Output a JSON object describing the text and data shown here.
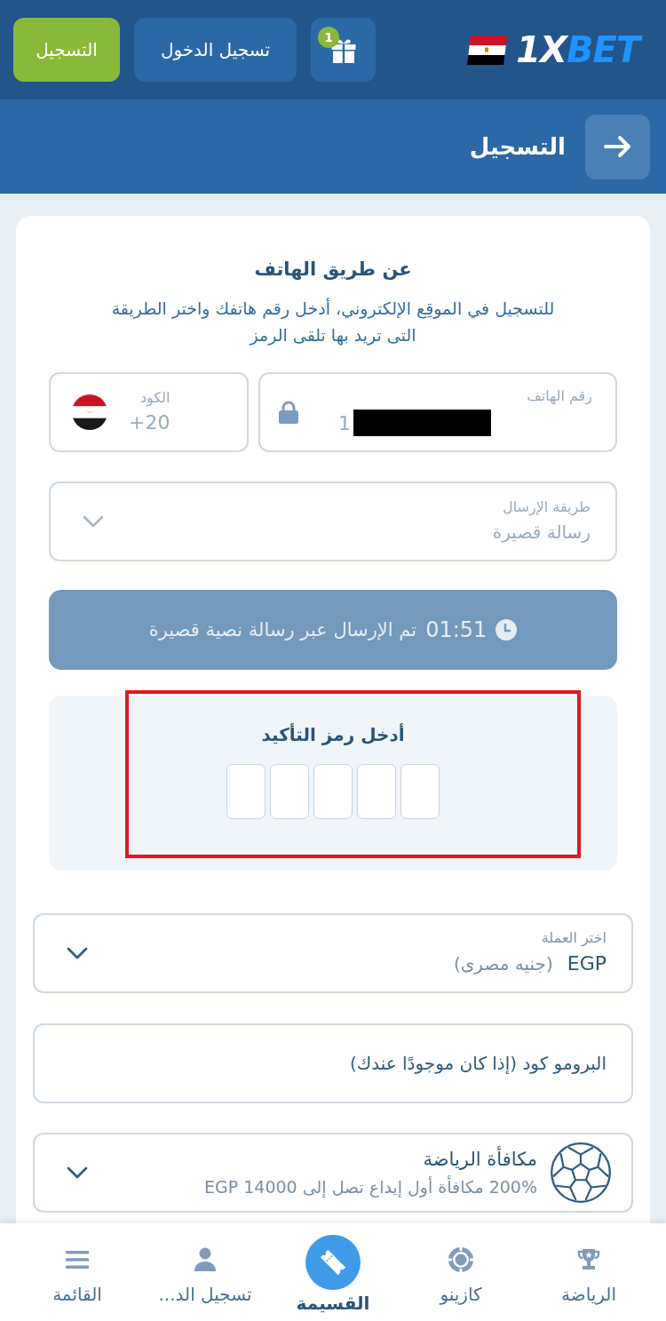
{
  "top_bar": {
    "logo": {
      "first_part": "1X",
      "second_part": "BET"
    },
    "gift_badge": "1",
    "login_button": "تسجيل الدخول",
    "register_button": "التسجيل"
  },
  "title_bar": {
    "title": "التسجيل"
  },
  "form": {
    "heading": "عن طريق الهاتف",
    "description": "للتسجيل في الموقِع الإلكتروني، أدخل رقم هاتفك واختر الطريقة التى تريد بها تلقى الرمز",
    "code_field": {
      "label": "الكود",
      "value": "+20"
    },
    "phone_field": {
      "label": "رقم الهاتف",
      "value": "1",
      "locked": true,
      "redacted": true
    },
    "send_method": {
      "label": "طريقة الإرسال",
      "value": "رسالة قصيرة"
    },
    "timer": {
      "time": "01:51",
      "message": "تم الإرسال عبر رسالة نصية قصيرة"
    },
    "confirmation": {
      "title": "أدخل رمز التأكيد",
      "highlighted": true,
      "cells": [
        {
          "filled": false
        },
        {
          "filled": false
        },
        {
          "filled": false
        },
        {
          "filled": false
        },
        {
          "filled": false
        }
      ]
    },
    "currency": {
      "label": "اختر العملة",
      "code": "EGP",
      "name": "(جنيه مصرى)"
    },
    "promo_code": {
      "placeholder": "البرومو كود (إذا كان موجودًا عندك)"
    },
    "bonus": {
      "title": "مكافأة الرياضة",
      "description": "200% مكافأة أول إيداع تصل إلى EGP 14000"
    }
  },
  "bottom_nav": [
    {
      "kind": "sports",
      "label": "الرياضة",
      "selected": false
    },
    {
      "kind": "casino",
      "label": "كازينو",
      "selected": false
    },
    {
      "kind": "coupon",
      "label": "القسيمة",
      "selected": true
    },
    {
      "kind": "login",
      "label": "تسجيل الد...",
      "selected": false
    },
    {
      "kind": "menu",
      "label": "القائمة",
      "selected": false
    }
  ]
}
